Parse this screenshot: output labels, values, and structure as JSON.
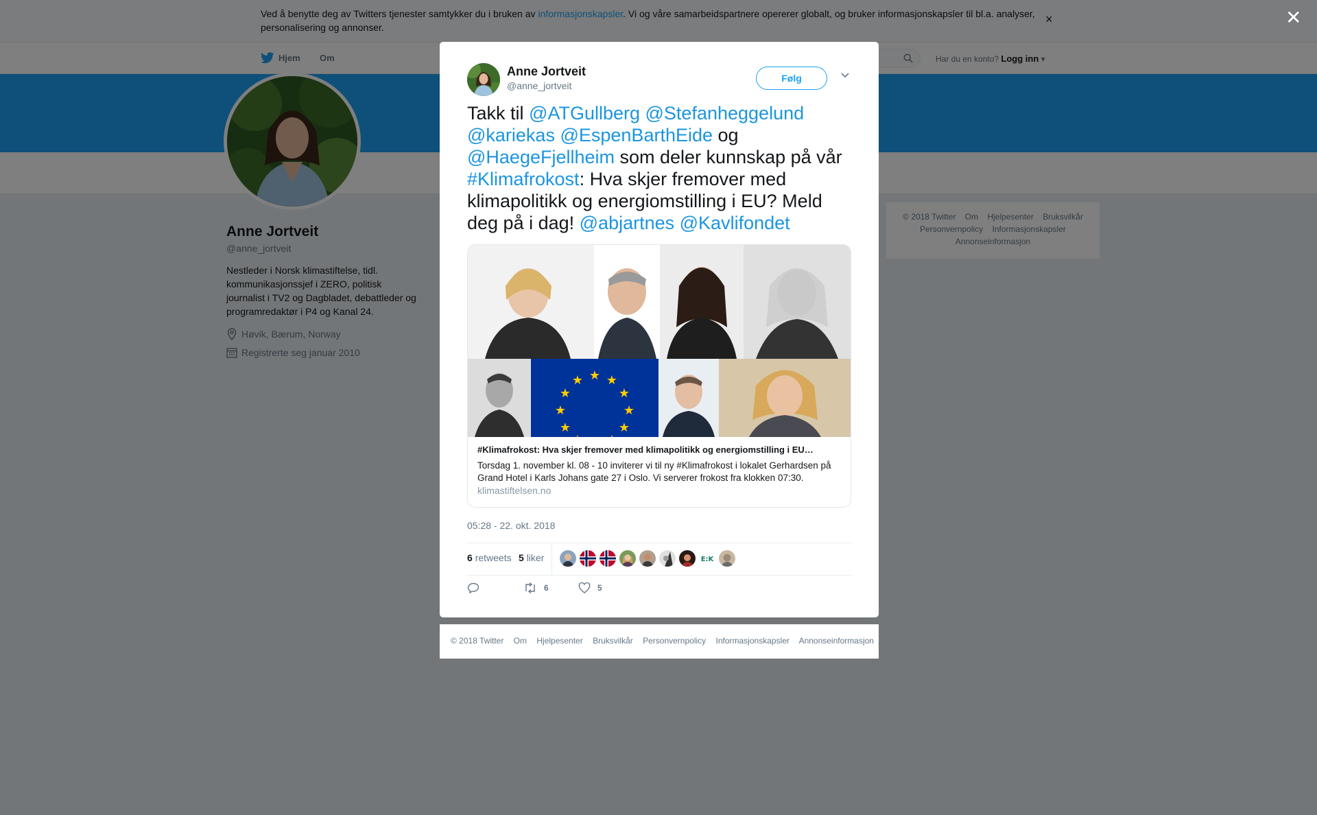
{
  "cookie_banner": {
    "text_before": "Ved å benytte deg av Twitters tjenester samtykker du i bruken av ",
    "link": "informasjonskapsler",
    "text_after": ". Vi og våre samarbeidspartnere opererer globalt, og bruker informasjonskapsler til bl.a. analyser, personalisering og annonser.",
    "close": "×"
  },
  "nav": {
    "home": "Hjem",
    "about": "Om",
    "login_prompt": "Har du en konto?",
    "login": "Logg inn"
  },
  "profile": {
    "name": "Anne Jortveit",
    "handle": "@anne_jortveit",
    "bio": "Nestleder i Norsk klimastiftelse, tidl. kommunikasjonssjef i ZERO, politisk journalist i TV2 og Dagbladet, debattleder og programredaktør i P4 og Kanal 24.",
    "location": "Høvik, Bærum, Norway",
    "joined": "Registrerte seg januar 2010"
  },
  "side_footer": [
    "© 2018 Twitter",
    "Om",
    "Hjelpesenter",
    "Bruksvilkår",
    "Personvernpolicy",
    "Informasjonskapsler",
    "Annonseinformasjon"
  ],
  "overlay_close": "✕",
  "tweet": {
    "author_name": "Anne Jortveit",
    "author_handle": "@anne_jortveit",
    "follow_label": "Følg",
    "segments": [
      {
        "text": "Takk til ",
        "link": false
      },
      {
        "text": "@ATGullberg",
        "link": true
      },
      {
        "text": " ",
        "link": false
      },
      {
        "text": "@Stefanheggelund",
        "link": true
      },
      {
        "text": " ",
        "link": false
      },
      {
        "text": "@kariekas",
        "link": true
      },
      {
        "text": " ",
        "link": false
      },
      {
        "text": "@EspenBarthEide",
        "link": true
      },
      {
        "text": " og ",
        "link": false
      },
      {
        "text": "@HaegeFjellheim",
        "link": true
      },
      {
        "text": " som deler kunnskap på vår ",
        "link": false
      },
      {
        "text": "#Klimafrokost",
        "link": true
      },
      {
        "text": ": Hva skjer fremover med klimapolitikk og energiomstilling i EU? Meld deg på i dag! ",
        "link": false
      },
      {
        "text": "@abjartnes",
        "link": true
      },
      {
        "text": " ",
        "link": false
      },
      {
        "text": "@Kavlifondet",
        "link": true
      }
    ],
    "card": {
      "title": "#Klimafrokost: Hva skjer fremover med klimapolitikk og energiomstilling i EU…",
      "description": "Torsdag 1. november kl. 08 - 10 inviterer vi til ny #Klimafrokost i lokalet Gerhardsen på Grand Hotel i Karls Johans gate 27 i Oslo. Vi serverer frokost fra klokken 07:30.",
      "domain": "klimastiftelsen.no"
    },
    "timestamp": "05:28 - 22. okt. 2018",
    "retweets_count": "6",
    "retweets_label": "retweets",
    "likes_count": "5",
    "likes_label": "liker",
    "action_retweet_count": "6",
    "action_like_count": "5"
  },
  "modal_footer": [
    "© 2018 Twitter",
    "Om",
    "Hjelpesenter",
    "Bruksvilkår",
    "Personvernpolicy",
    "Informasjonskapsler",
    "Annonseinformasjon"
  ],
  "colors": {
    "link": "#1b95e0",
    "brand": "#1da1f2",
    "muted": "#657786",
    "overlay": "rgba(0,0,0,0.5)"
  },
  "icons": [
    "twitter-bird-icon",
    "search-icon",
    "location-pin-icon",
    "calendar-icon",
    "chevron-down-icon",
    "reply-icon",
    "retweet-icon",
    "heart-icon",
    "close-icon"
  ]
}
